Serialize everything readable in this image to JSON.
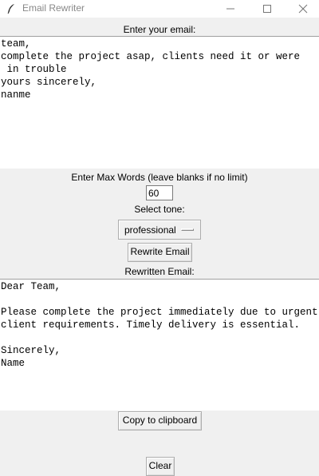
{
  "window": {
    "title": "Email Rewriter"
  },
  "input": {
    "label": "Enter your email:",
    "text": "team,\ncomplete the project asap, clients need it or were\n in trouble\nyours sincerely,\nnanme"
  },
  "max_words": {
    "label": "Enter Max Words (leave blanks if no limit)",
    "value": "60"
  },
  "tone": {
    "label": "Select tone:",
    "selected": "professional"
  },
  "buttons": {
    "rewrite": "Rewrite Email",
    "copy": "Copy to clipboard",
    "clear": "Clear"
  },
  "output": {
    "label": "Rewritten Email:",
    "text": "Dear Team,\n\nPlease complete the project immediately due to urgent client requirements. Timely delivery is essential.\n\nSincerely,\nName"
  }
}
